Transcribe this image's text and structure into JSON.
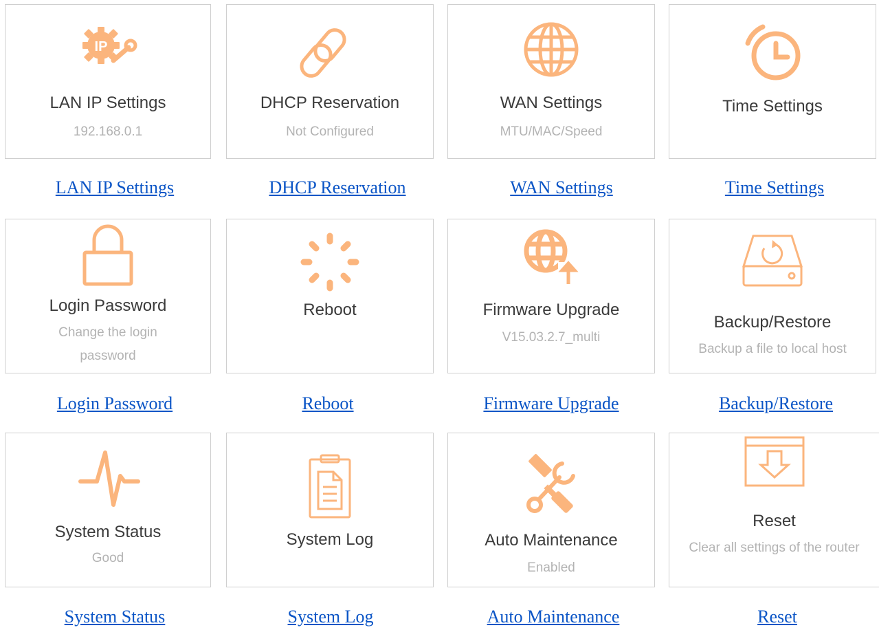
{
  "icon_color": "#fbb57d",
  "link_color": "#0b55c6",
  "tiles": [
    {
      "title": "LAN IP Settings",
      "subtitle": "192.168.0.1",
      "icon": "ip-gear-wrench-icon",
      "link": "LAN IP Settings"
    },
    {
      "title": "DHCP Reservation",
      "subtitle": "Not Configured",
      "icon": "link-icon",
      "link": "DHCP Reservation"
    },
    {
      "title": "WAN Settings",
      "subtitle": "MTU/MAC/Speed",
      "icon": "globe-icon",
      "link": "WAN Settings"
    },
    {
      "title": "Time Settings",
      "subtitle": "",
      "icon": "alarm-clock-icon",
      "link": "Time Settings"
    },
    {
      "title": "Login Password",
      "subtitle": "Change the login password",
      "icon": "lock-icon",
      "link": "Login Password"
    },
    {
      "title": "Reboot",
      "subtitle": "",
      "icon": "spinner-icon",
      "link": "Reboot"
    },
    {
      "title": "Firmware Upgrade",
      "subtitle": "V15.03.2.7_multi",
      "icon": "globe-upload-icon",
      "link": "Firmware Upgrade"
    },
    {
      "title": "Backup/Restore",
      "subtitle": "Backup a file to local host",
      "icon": "drive-restore-icon",
      "link": "Backup/Restore"
    },
    {
      "title": "System Status",
      "subtitle": "Good",
      "icon": "pulse-icon",
      "link": "System Status"
    },
    {
      "title": "System Log",
      "subtitle": "",
      "icon": "clipboard-log-icon",
      "link": "System Log"
    },
    {
      "title": "Auto Maintenance",
      "subtitle": "Enabled",
      "icon": "tools-icon",
      "link": "Auto Maintenance"
    },
    {
      "title": "Reset",
      "subtitle": "Clear all settings of the router",
      "icon": "reset-box-icon",
      "link": "Reset"
    }
  ]
}
